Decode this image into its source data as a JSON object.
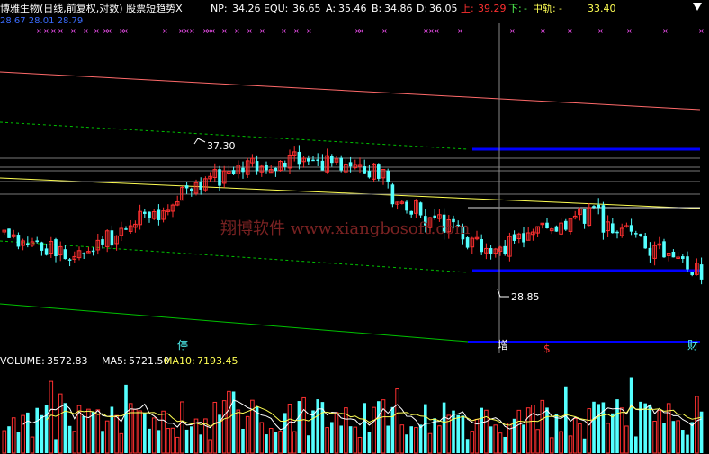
{
  "title": "博雅生物(日线,前复权,对数) 股票短趋势X",
  "header": {
    "np_label": "NP:",
    "np_value": "34.26",
    "equ_label": "EQU:",
    "equ_value": "36.65",
    "a_label": "A:",
    "a_value": "35.46",
    "b_label": "B:",
    "b_value": "34.86",
    "d_label": "D:",
    "d_value": "36.05",
    "up_label": "上:",
    "up_value": "39.29",
    "down_label": "下:",
    "down_value": "-",
    "mid_label": "中轨:",
    "mid_value": "-",
    "extra_value": "33.40",
    "sub_values": "28.67  28.01  28.79"
  },
  "price_chart": {
    "high_label": "37.30",
    "low_label": "28.85",
    "watermark": "翔博软件 www.xiangbosoft.com",
    "markers": {
      "stop": "停",
      "add": "增",
      "dollar": "$",
      "cai": "财"
    }
  },
  "volume": {
    "label": "VOLUME:",
    "value": "3572.83",
    "ma5_label": "MA5:",
    "ma5_value": "5721.50",
    "ma10_label": "MA10:",
    "ma10_value": "7193.45"
  },
  "colors": {
    "up": "#ff3030",
    "down": "#54ffff",
    "background": "#000000",
    "yellow": "#ffff54",
    "white": "#ffffff",
    "blue": "#0000ff",
    "magenta": "#ff54ff",
    "green": "#00c000"
  }
}
